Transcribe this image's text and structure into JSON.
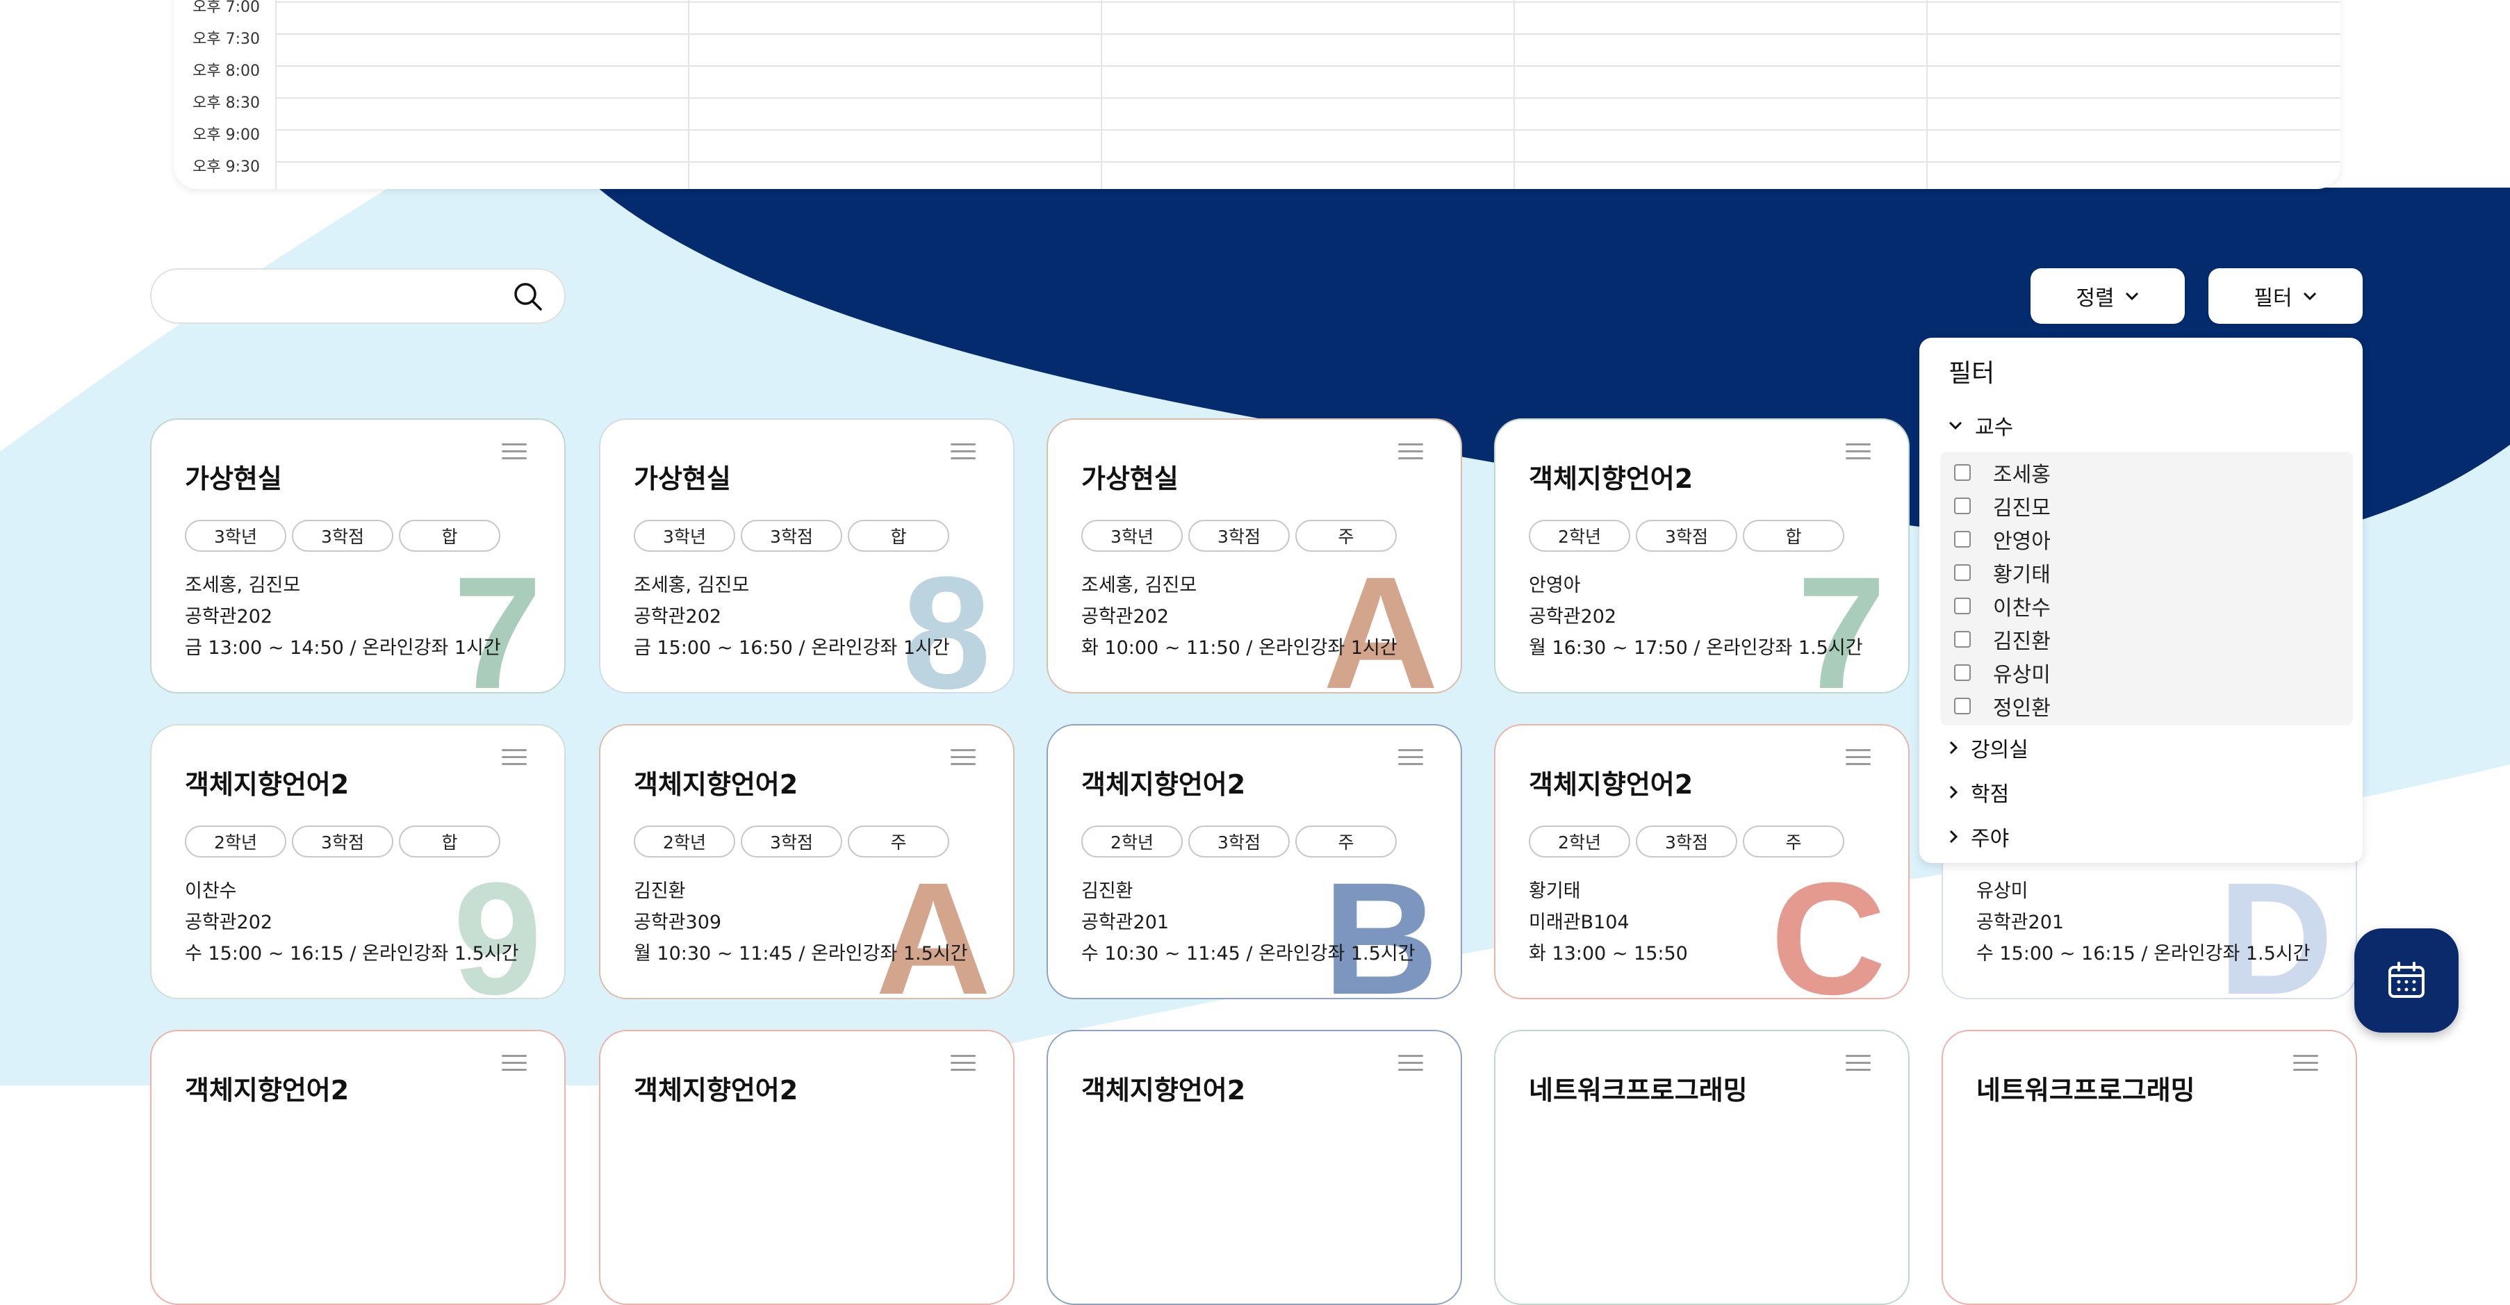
{
  "schedule": {
    "times": [
      "오후 7:00",
      "오후 7:30",
      "오후 8:00",
      "오후 8:30",
      "오후 9:00",
      "오후 9:30"
    ]
  },
  "search": {
    "placeholder": "",
    "value": ""
  },
  "toolbar": {
    "sort_label": "정렬",
    "filter_label": "필터"
  },
  "colors": {
    "navy": "#032B6E",
    "light_blue": "#DBF2FB",
    "green": "#A9CDBA",
    "blue_gray": "#BCD3E0",
    "tan": "#D2A58C",
    "navy_letter": "#7C96BF",
    "coral": "#E49A8E",
    "periwinkle": "#CDD9EC"
  },
  "cards": [
    {
      "title": "가상현실",
      "chips": [
        "3학년",
        "3학점",
        "합"
      ],
      "professor": "조세홍, 김진모",
      "room": "공학관202",
      "time": "금 13:00 ~ 14:50 / 온라인강좌 1시간",
      "letter": "7"
    },
    {
      "title": "가상현실",
      "chips": [
        "3학년",
        "3학점",
        "합"
      ],
      "professor": "조세홍, 김진모",
      "room": "공학관202",
      "time": "금 15:00 ~ 16:50 / 온라인강좌 1시간",
      "letter": "8"
    },
    {
      "title": "가상현실",
      "chips": [
        "3학년",
        "3학점",
        "주"
      ],
      "professor": "조세홍, 김진모",
      "room": "공학관202",
      "time": "화 10:00 ~ 11:50 / 온라인강좌 1시간",
      "letter": "A"
    },
    {
      "title": "객체지향언어2",
      "chips": [
        "2학년",
        "3학점",
        "합"
      ],
      "professor": "안영아",
      "room": "공학관202",
      "time": "월 16:30 ~ 17:50 / 온라인강좌 1.5시간",
      "letter": "7"
    },
    {
      "title": "객체지향언어2",
      "chips": [
        "2학년",
        "3학점",
        "합"
      ],
      "professor": "이찬수",
      "room": "공학관202",
      "time": "수 15:00 ~ 16:15 / 온라인강좌 1.5시간",
      "letter": "9"
    },
    {
      "title": "객체지향언어2",
      "chips": [
        "2학년",
        "3학점",
        "주"
      ],
      "professor": "김진환",
      "room": "공학관309",
      "time": "월 10:30 ~ 11:45 / 온라인강좌 1.5시간",
      "letter": "A"
    },
    {
      "title": "객체지향언어2",
      "chips": [
        "2학년",
        "3학점",
        "주"
      ],
      "professor": "김진환",
      "room": "공학관201",
      "time": "수 10:30 ~ 11:45 / 온라인강좌 1.5시간",
      "letter": "B"
    },
    {
      "title": "객체지향언어2",
      "chips": [
        "2학년",
        "3학점",
        "주"
      ],
      "professor": "황기태",
      "room": "미래관B104",
      "time": "화 13:00 ~ 15:50",
      "letter": "C"
    },
    {
      "title": "",
      "chips": [],
      "professor": "유상미",
      "room": "공학관201",
      "time": "수 15:00 ~ 16:15 / 온라인강좌 1.5시간",
      "letter": "D"
    },
    {
      "title": "객체지향언어2",
      "letter": ""
    },
    {
      "title": "객체지향언어2",
      "letter": ""
    },
    {
      "title": "객체지향언어2",
      "letter": ""
    },
    {
      "title": "네트워크프로그래밍",
      "letter": ""
    },
    {
      "title": "네트워크프로그래밍",
      "letter": ""
    }
  ],
  "filter_panel": {
    "title": "필터",
    "sections": {
      "professor": "교수",
      "classroom": "강의실",
      "credit": "학점",
      "day_night": "주야"
    },
    "professors": [
      "조세홍",
      "김진모",
      "안영아",
      "황기태",
      "이찬수",
      "김진환",
      "유상미",
      "정인환"
    ]
  },
  "fab": {
    "icon": "calendar-icon"
  }
}
